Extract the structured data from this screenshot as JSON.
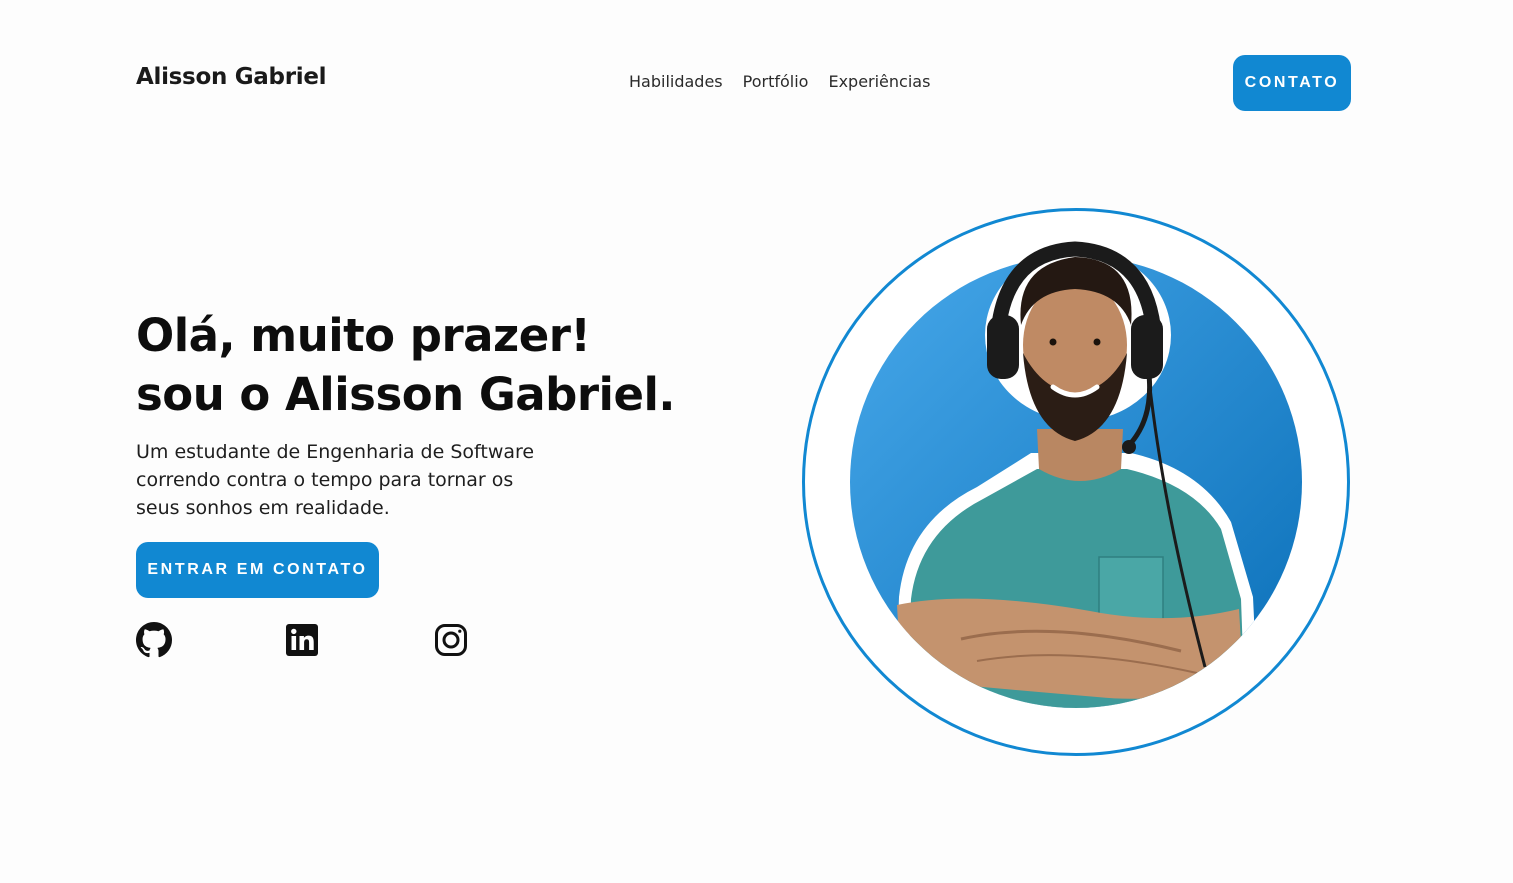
{
  "header": {
    "brand": "Alisson Gabriel",
    "nav": [
      {
        "label": "Habilidades"
      },
      {
        "label": "Portfólio"
      },
      {
        "label": "Experiências"
      }
    ],
    "cta_label": "CONTATO"
  },
  "hero": {
    "title_line1": "Olá, muito prazer!",
    "title_line2": "sou o Alisson Gabriel.",
    "description": "Um estudante de Engenharia de Software correndo contra o tempo para tornar os seus sonhos em realidade.",
    "cta_label": "ENTRAR EM CONTATO"
  },
  "socials": [
    {
      "icon": "github-icon"
    },
    {
      "icon": "linkedin-icon"
    },
    {
      "icon": "instagram-icon"
    }
  ],
  "colors": {
    "accent": "#1188d2",
    "text": "#111111",
    "background": "#fdfdfd"
  }
}
